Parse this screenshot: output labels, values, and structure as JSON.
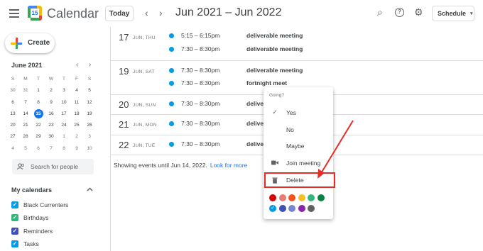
{
  "header": {
    "app_title": "Calendar",
    "logo_text": "15",
    "today_label": "Today",
    "prev_icon": "‹",
    "next_icon": "›",
    "date_range": "Jun 2021 – Jun 2022",
    "view_label": "Schedule",
    "view_caret": "▾",
    "search_icon": "⌕",
    "help_icon": "?",
    "settings_icon": "⚙"
  },
  "sidebar": {
    "create_label": "Create",
    "mini_cal": {
      "month_label": "June 2021",
      "prev": "‹",
      "next": "›",
      "dow": [
        "S",
        "M",
        "T",
        "W",
        "T",
        "F",
        "S"
      ],
      "weeks": [
        [
          "30",
          "31",
          "1",
          "2",
          "3",
          "4",
          "5"
        ],
        [
          "6",
          "7",
          "8",
          "9",
          "10",
          "11",
          "12"
        ],
        [
          "13",
          "14",
          "15",
          "16",
          "17",
          "18",
          "19"
        ],
        [
          "20",
          "21",
          "22",
          "23",
          "24",
          "25",
          "26"
        ],
        [
          "27",
          "28",
          "29",
          "30",
          "1",
          "2",
          "3"
        ],
        [
          "4",
          "5",
          "6",
          "7",
          "8",
          "9",
          "10"
        ]
      ],
      "today": "15"
    },
    "search_people_placeholder": "Search for people",
    "my_calendars_title": "My calendars",
    "calendars": [
      {
        "label": "Black Currenters",
        "color": "#039be5"
      },
      {
        "label": "Birthdays",
        "color": "#33b679"
      },
      {
        "label": "Reminders",
        "color": "#3f51b5"
      },
      {
        "label": "Tasks",
        "color": "#039be5"
      }
    ]
  },
  "schedule": {
    "days": [
      {
        "num": "17",
        "dow": "JUN, THU",
        "events": [
          {
            "time": "5:15 – 6:15pm",
            "title": "deliverable meeting"
          },
          {
            "time": "7:30 – 8:30pm",
            "title": "deliverable meeting"
          }
        ]
      },
      {
        "num": "19",
        "dow": "JUN, SAT",
        "events": [
          {
            "time": "7:30 – 8:30pm",
            "title": "deliverable meeting"
          },
          {
            "time": "7:30 – 8:30pm",
            "title": "fortnight meet"
          }
        ]
      },
      {
        "num": "20",
        "dow": "JUN, SUN",
        "events": [
          {
            "time": "7:30 – 8:30pm",
            "title": "delive"
          }
        ]
      },
      {
        "num": "21",
        "dow": "JUN, MON",
        "events": [
          {
            "time": "7:30 – 8:30pm",
            "title": "delive"
          }
        ]
      },
      {
        "num": "22",
        "dow": "JUN, TUE",
        "events": [
          {
            "time": "7:30 – 8:30pm",
            "title": "delive"
          }
        ]
      }
    ],
    "showing_text": "Showing events until Jun 14, 2022.",
    "look_more": "Look for more"
  },
  "popup": {
    "going_label": "Going?",
    "options": [
      {
        "icon": "✓",
        "label": "Yes"
      },
      {
        "icon": "",
        "label": "No"
      },
      {
        "icon": "",
        "label": "Maybe"
      },
      {
        "icon": "■",
        "label": "Join meeting"
      },
      {
        "icon": "🗑",
        "label": "Delete"
      }
    ],
    "colors_row1": [
      "#d50000",
      "#e67c73",
      "#f4511e",
      "#f6bf26",
      "#33b679",
      "#0b8043"
    ],
    "colors_row2": [
      "#039be5",
      "#3f51b5",
      "#7986cb",
      "#8e24aa",
      "#616161"
    ],
    "selected_check": "✓"
  },
  "annotation": {
    "highlight_color": "#e52d27"
  }
}
